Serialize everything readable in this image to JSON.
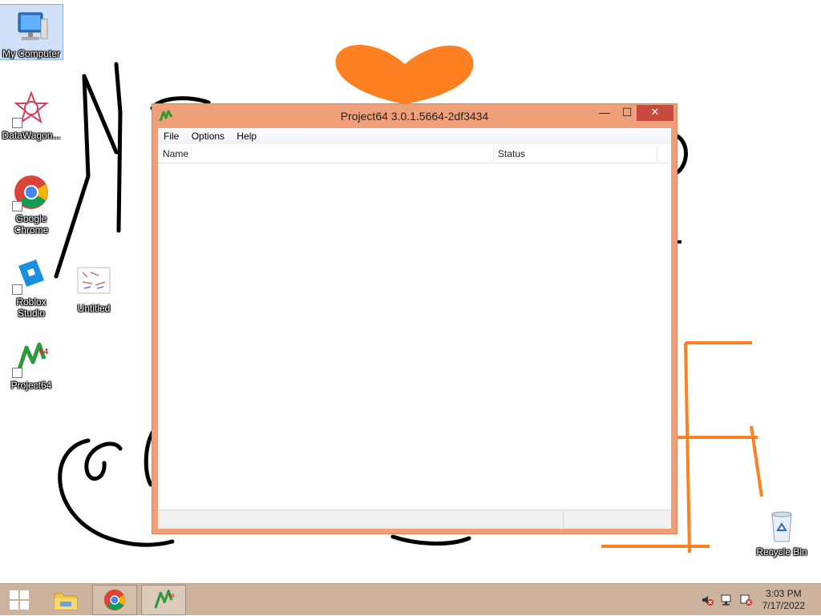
{
  "desktop": {
    "icons": [
      {
        "label": "My Computer"
      },
      {
        "label": "DataWagon..."
      },
      {
        "label": "Google Chrome"
      },
      {
        "label": "Roblox Studio"
      },
      {
        "label": "Untitled"
      },
      {
        "label": "Project64"
      },
      {
        "label": "Recycle Bin"
      }
    ]
  },
  "window": {
    "title": "Project64 3.0.1.5664-2df3434",
    "controls": {
      "minimize": "—",
      "maximize": "☐",
      "close": "✕"
    },
    "menu": [
      "File",
      "Options",
      "Help"
    ],
    "columns": [
      "Name",
      "Status"
    ]
  },
  "taskbar": {
    "clock_time": "3:03 PM",
    "clock_date": "7/17/2022"
  },
  "colors": {
    "window_frame": "#f0a078",
    "close_button": "#c74a3f",
    "taskbar": "#cdb39e",
    "drawing_orange": "#ff8020"
  }
}
